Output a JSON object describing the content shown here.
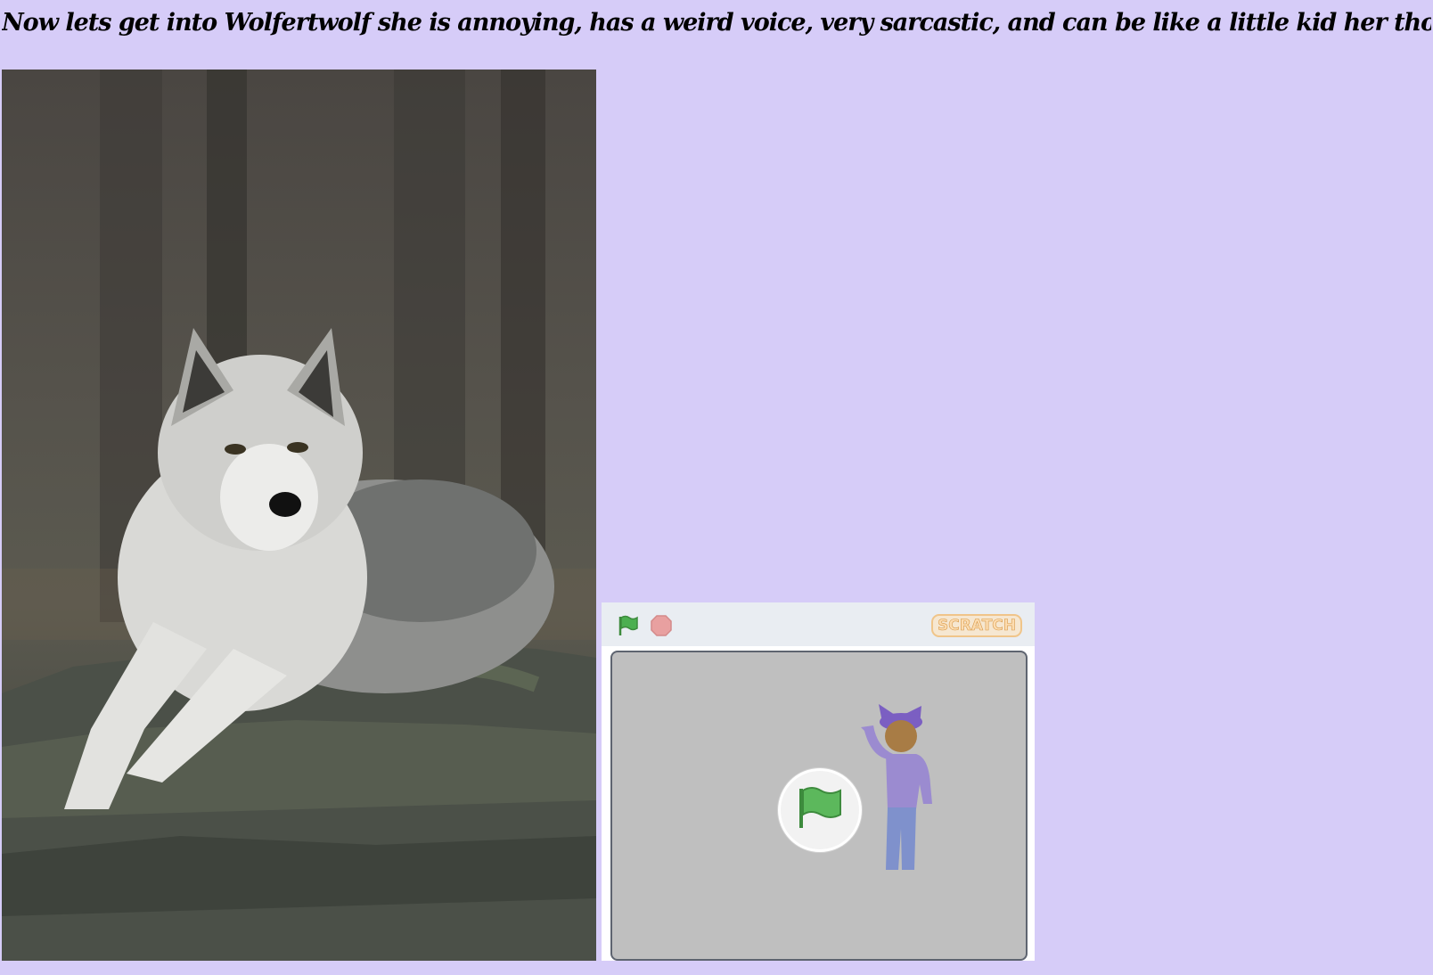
{
  "heading": {
    "text": "Now lets get into Wolfertwolf she is annoying, has a weird voice, very sarcastic, and can be like a little kid her thoughts just spill out"
  },
  "photo": {
    "icon": "wolf-photo"
  },
  "scratch_player": {
    "toolbar": {
      "green_flag_icon": "green-flag-icon",
      "stop_icon": "stop-sign-icon",
      "logo_text": "SCRATCH"
    },
    "stage": {
      "play_overlay_icon": "green-flag-icon",
      "sprite": "wolf-girl-sprite"
    }
  },
  "colors": {
    "page_background": "#d6ccf8",
    "toolbar": "#e9edf2",
    "stage": "#bfbfbf",
    "flag_green": "#4caf50",
    "stop_red": "#e8a0a0",
    "sprite_hair": "#7b5fc2",
    "sprite_shirt": "#9b8bd0",
    "sprite_pants": "#7f91cc",
    "sprite_skin": "#a87c45"
  }
}
